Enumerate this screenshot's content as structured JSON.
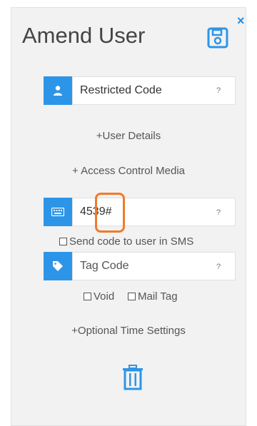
{
  "dialog": {
    "title": "Amend User",
    "close_glyph": "×"
  },
  "fields": {
    "restricted_code": {
      "value": "Restricted Code",
      "help": "?",
      "icon": "user-icon"
    },
    "pin_code": {
      "value": "4539#",
      "help": "?",
      "icon": "keyboard-icon"
    },
    "tag_code": {
      "placeholder": "Tag Code",
      "help": "?",
      "icon": "tag-icon"
    }
  },
  "links": {
    "user_details": "+User Details",
    "access_control_media": "+ Access Control Media",
    "optional_time_settings": "+Optional Time Settings"
  },
  "checkboxes": {
    "send_sms": "Send code to user in SMS",
    "void": "Void",
    "mail_tag": "Mail Tag"
  },
  "colors": {
    "accent": "#2d95e8",
    "highlight": "#f07b2a"
  }
}
